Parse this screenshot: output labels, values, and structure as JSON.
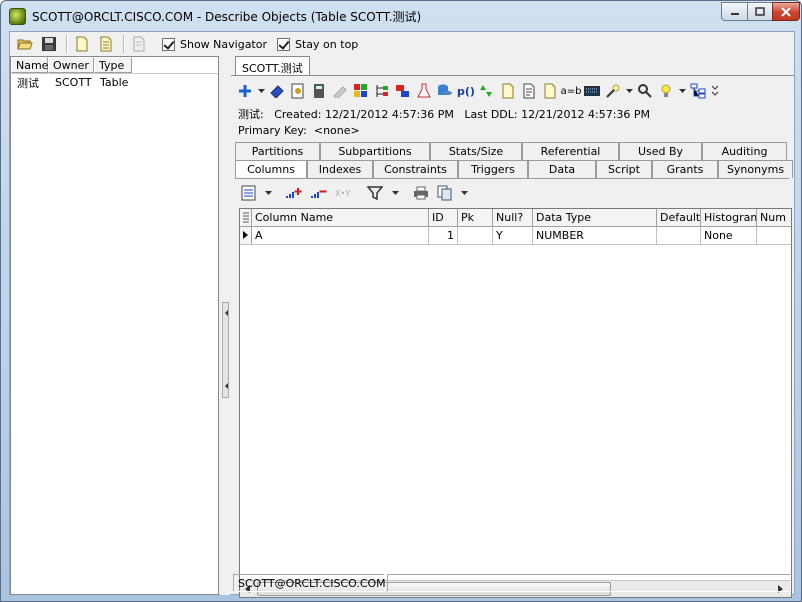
{
  "window": {
    "title": "SCOTT@ORCLT.CISCO.COM - Describe Objects (Table SCOTT.测试)"
  },
  "toolbar": {
    "show_navigator_label": "Show Navigator",
    "show_navigator_checked": true,
    "stay_on_top_label": "Stay on top",
    "stay_on_top_checked": true
  },
  "navigator": {
    "columns": [
      "Name",
      "Owner",
      "Type"
    ],
    "rows": [
      {
        "name": "测试",
        "owner": "SCOTT",
        "type": "Table"
      }
    ]
  },
  "document_tab": "SCOTT.测试",
  "object_info": {
    "name": "测试:",
    "created_label": "Created:",
    "created": "12/21/2012 4:57:36 PM",
    "last_ddl_label": "Last DDL:",
    "last_ddl": "12/21/2012 4:57:36 PM",
    "primary_key_label": "Primary Key:",
    "primary_key": "<none>"
  },
  "tabs_top": [
    "Partitions",
    "Subpartitions",
    "Stats/Size",
    "Referential",
    "Used By",
    "Auditing"
  ],
  "tabs_bottom": [
    "Columns",
    "Indexes",
    "Constraints",
    "Triggers",
    "Data",
    "Script",
    "Grants",
    "Synonyms"
  ],
  "active_tab": "Columns",
  "grid": {
    "headers": [
      "Column Name",
      "ID",
      "Pk",
      "Null?",
      "Data Type",
      "Default",
      "Histogram",
      "Num"
    ],
    "rows": [
      {
        "column_name": "A",
        "id": "1",
        "pk": "",
        "null": "Y",
        "data_type": "NUMBER",
        "default": "",
        "histogram": "None",
        "num": ""
      }
    ]
  },
  "status": {
    "connection": "SCOTT@ORCLT.CISCO.COM",
    "message": ""
  },
  "icons": {
    "object_toolbar_text_icons": [
      "p()",
      "a=b"
    ]
  }
}
